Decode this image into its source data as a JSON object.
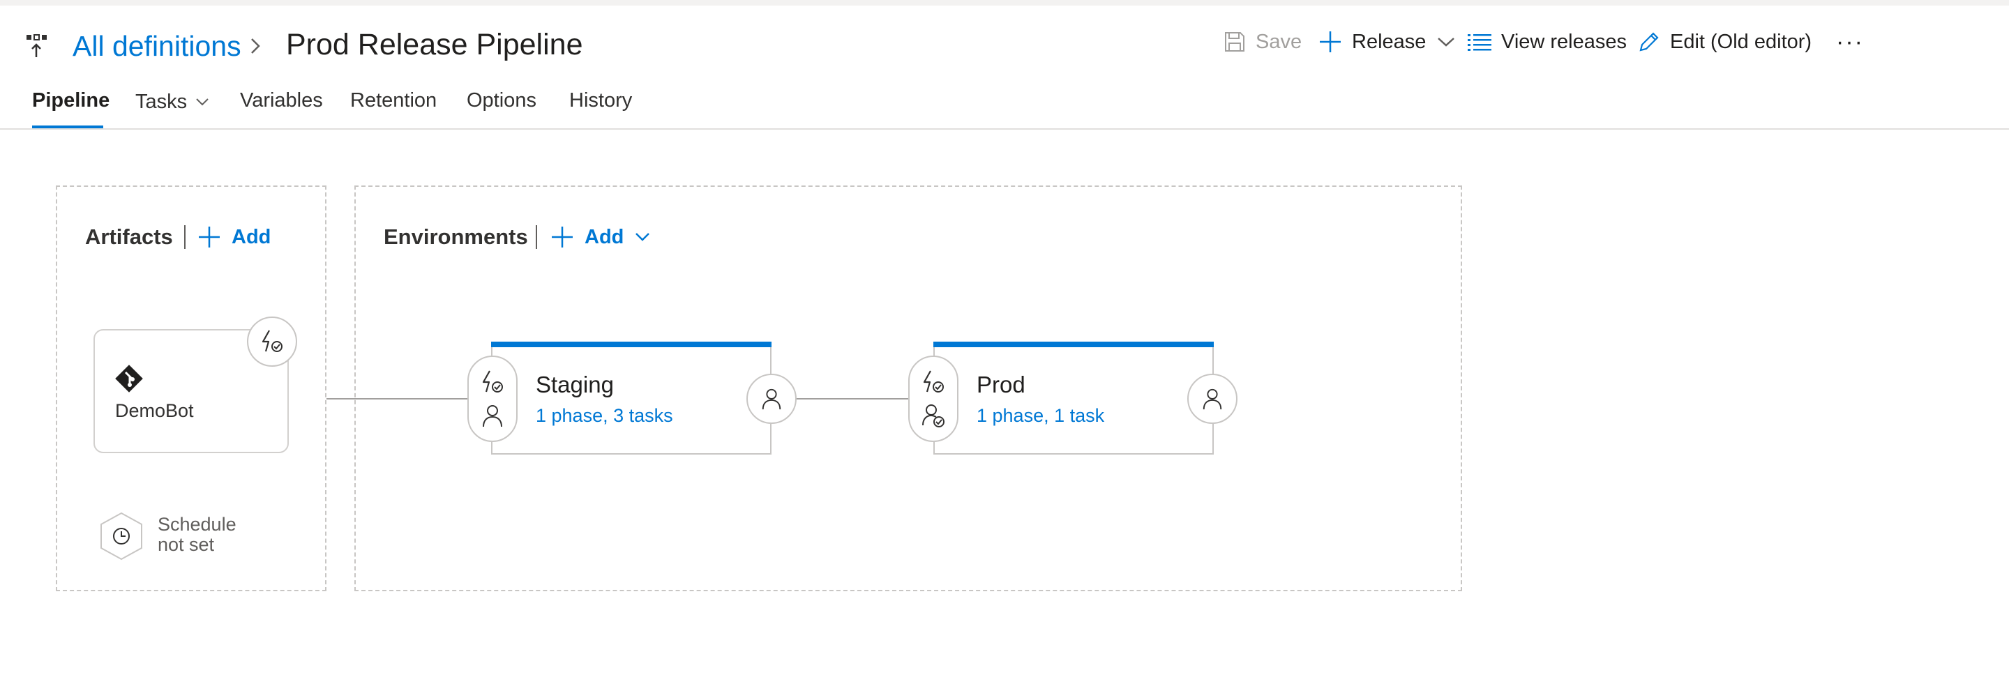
{
  "header": {
    "breadcrumb_link": "All definitions",
    "title": "Prod Release Pipeline"
  },
  "toolbar": {
    "save_label": "Save",
    "release_label": "Release",
    "view_releases_label": "View releases",
    "edit_label": "Edit (Old editor)",
    "more_label": "···"
  },
  "tabs": [
    {
      "label": "Pipeline",
      "active": true
    },
    {
      "label": "Tasks"
    },
    {
      "label": "Variables"
    },
    {
      "label": "Retention"
    },
    {
      "label": "Options"
    },
    {
      "label": "History"
    }
  ],
  "artifacts": {
    "title": "Artifacts",
    "add_label": "Add",
    "items": [
      {
        "name": "DemoBot",
        "icon": "git-icon"
      }
    ],
    "schedule_line1": "Schedule",
    "schedule_line2": "not set"
  },
  "environments": {
    "title": "Environments",
    "add_label": "Add",
    "items": [
      {
        "name": "Staging",
        "summary": "1 phase, 3 tasks"
      },
      {
        "name": "Prod",
        "summary": "1 phase, 1 task"
      }
    ]
  },
  "colors": {
    "accent": "#0078d4",
    "border": "#c8c6c4",
    "text": "#201f1e",
    "disabled": "#a19f9d"
  }
}
